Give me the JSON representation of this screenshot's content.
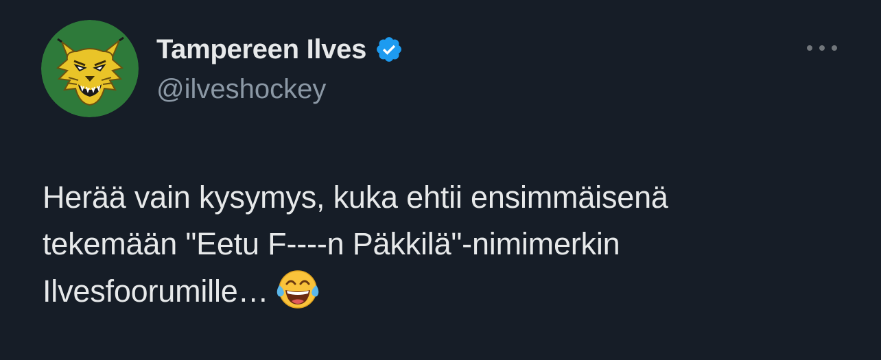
{
  "tweet": {
    "author": {
      "display_name": "Tampereen Ilves",
      "handle": "@ilveshockey",
      "avatar_icon": "lynx-logo",
      "avatar_background": "#2e7a3a",
      "verified": true,
      "verified_badge_color": "#1d9bf0"
    },
    "more_icon": "more-horizontal-icon",
    "text_lines": [
      "Herää vain kysymys, kuka ehtii ensimmäisenä",
      "tekemään \"Eetu F----n Päkkilä\"-nimimerkin",
      "Ilvesfoorumille…"
    ],
    "emoji": "face-with-tears-of-joy",
    "colors": {
      "background": "#161d27",
      "primary_text": "#e7e9ea",
      "secondary_text": "#8b98a5"
    }
  }
}
